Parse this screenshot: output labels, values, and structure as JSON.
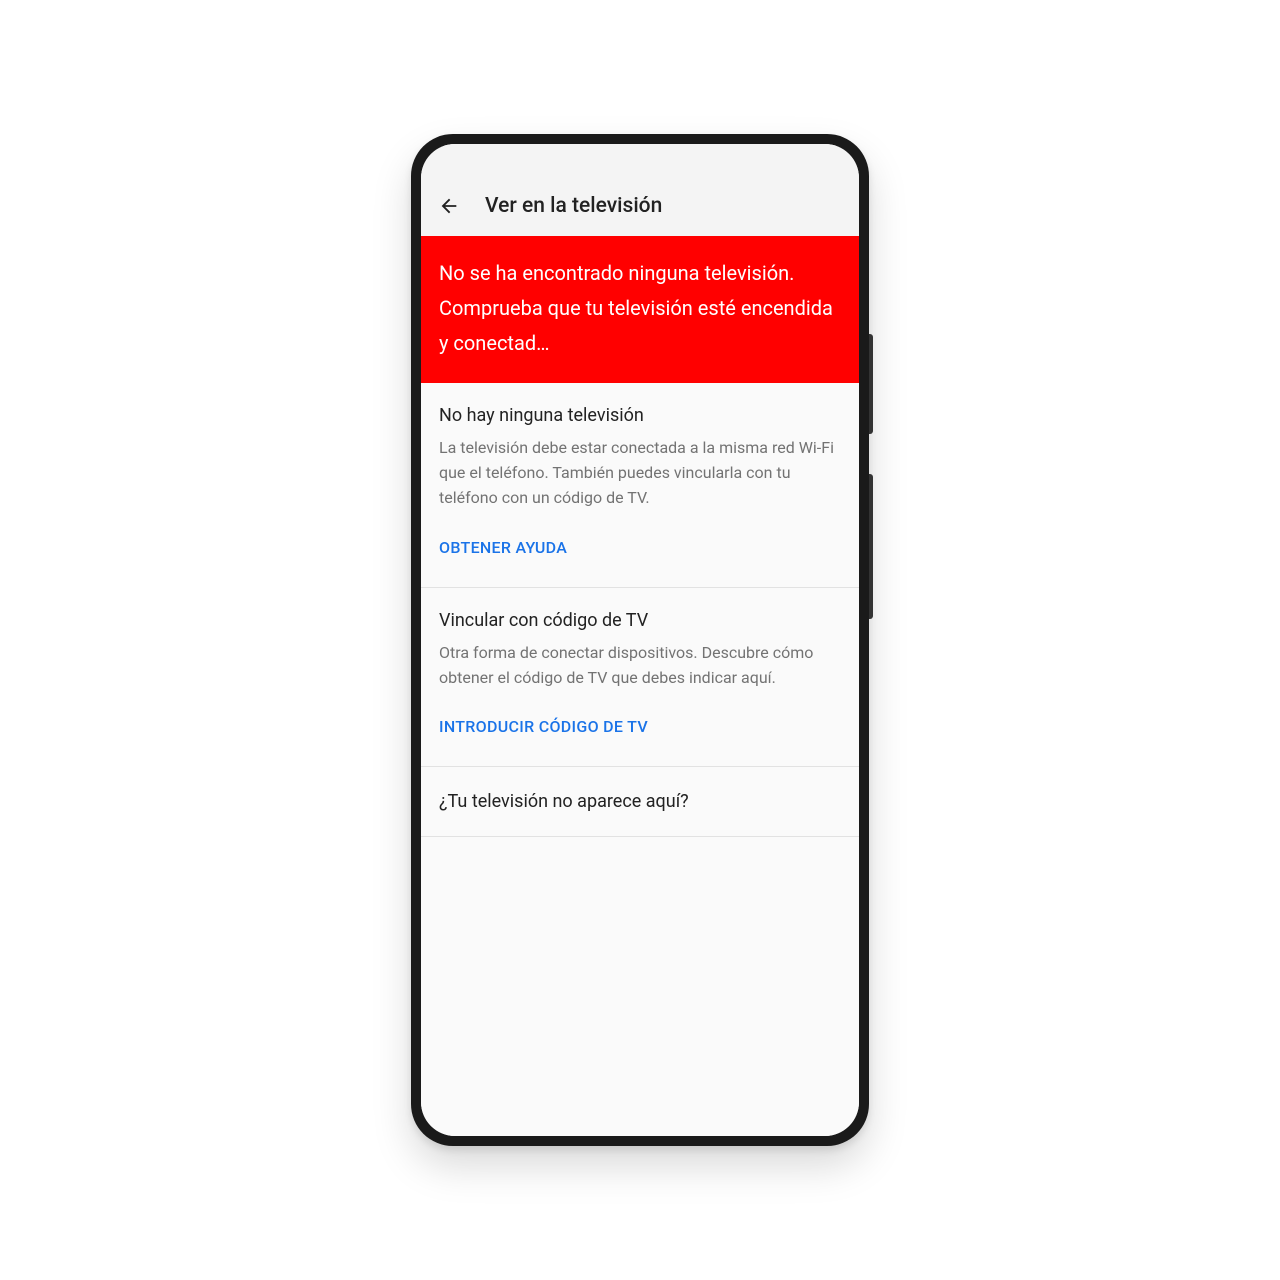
{
  "header": {
    "title": "Ver en la televisión"
  },
  "alert": {
    "message": "No se ha encontrado ninguna televisión. Comprueba que tu televisión esté encendida y conectad…"
  },
  "sections": {
    "notv": {
      "title": "No hay ninguna televisión",
      "body": "La televisión debe estar conectada a la misma red Wi-Fi que el teléfono. También puedes vincularla con tu teléfono con un código de TV.",
      "action": "OBTENER AYUDA"
    },
    "tvcode": {
      "title": "Vincular con código de TV",
      "body": "Otra forma de conectar dispositivos. Descubre cómo obtener el código de TV que debes indicar aquí.",
      "action": "INTRODUCIR CÓDIGO DE TV"
    },
    "question": {
      "text": "¿Tu televisión no aparece aquí?"
    }
  },
  "colors": {
    "alert_bg": "#ff0000",
    "link": "#1a73e8",
    "text_primary": "#222",
    "text_secondary": "#737373"
  }
}
